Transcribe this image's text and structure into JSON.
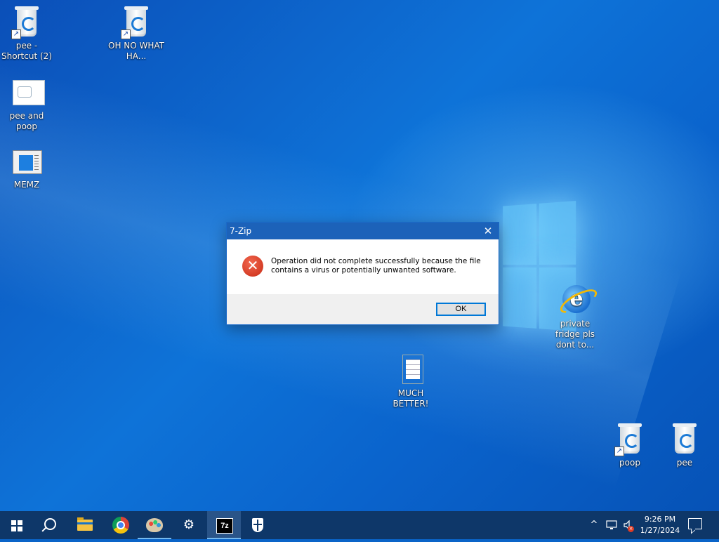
{
  "desktop": {
    "icons": [
      {
        "label": "pee - Shortcut (2)",
        "icon": "recycle-bin-icon",
        "shortcut": true
      },
      {
        "label": "OH NO WHAT HA...",
        "icon": "recycle-bin-icon",
        "shortcut": true
      },
      {
        "label": "pee and poop",
        "icon": "image-file-icon",
        "shortcut": false
      },
      {
        "label": "MEMZ",
        "icon": "application-icon",
        "shortcut": false
      },
      {
        "label": "private fridge pls dont to...",
        "icon": "internet-explorer-icon",
        "shortcut": false
      },
      {
        "label": "MUCH BETTER!",
        "icon": "text-document-icon",
        "shortcut": false
      },
      {
        "label": "poop",
        "icon": "recycle-bin-icon",
        "shortcut": true
      },
      {
        "label": "pee",
        "icon": "recycle-bin-icon",
        "shortcut": false
      }
    ]
  },
  "dialog": {
    "title": "7-Zip",
    "close_glyph": "✕",
    "icon": "error-icon",
    "message": "Operation did not complete successfully because the file contains a virus or potentially unwanted software.",
    "ok_label": "OK"
  },
  "taskbar": {
    "items": [
      {
        "name": "start-button",
        "icon": "windows-logo-icon"
      },
      {
        "name": "search-button",
        "icon": "search-icon"
      },
      {
        "name": "file-explorer",
        "icon": "folder-icon"
      },
      {
        "name": "google-chrome",
        "icon": "chrome-icon"
      },
      {
        "name": "paint",
        "icon": "palette-icon"
      },
      {
        "name": "settings",
        "icon": "gear-icon"
      },
      {
        "name": "7zip",
        "icon": "7zip-icon",
        "label": "7z",
        "active": true
      },
      {
        "name": "windows-security",
        "icon": "shield-icon"
      }
    ],
    "tray": {
      "chevron": "^",
      "time": "9:26 PM",
      "date": "1/27/2024"
    }
  },
  "colors": {
    "taskbar_bg": "#0e3769",
    "dialog_titlebar": "#1c62b9",
    "desktop_blue": "#0a64c8",
    "error_red": "#d63a22",
    "button_focus": "#0078d7"
  }
}
